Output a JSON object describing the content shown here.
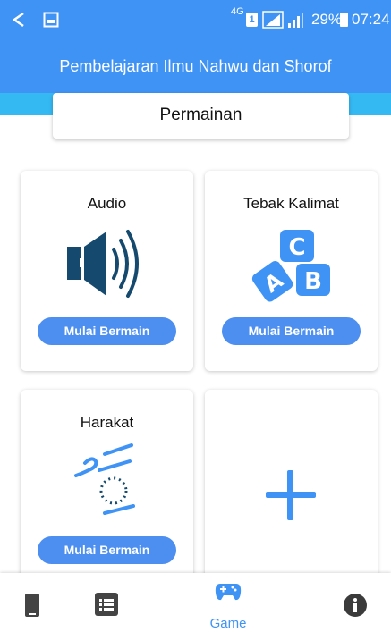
{
  "status_bar": {
    "network": "4G",
    "sim": "1",
    "battery": "29%",
    "time": "07:24"
  },
  "app_bar": {
    "title": "Pembelajaran Ilmu Nahwu dan Shorof"
  },
  "section": {
    "title": "Permainan"
  },
  "games": [
    {
      "title": "Audio",
      "icon": "speaker-icon",
      "button": "Mulai Bermain"
    },
    {
      "title": "Tebak Kalimat",
      "icon": "abc-blocks-icon",
      "button": "Mulai Bermain"
    },
    {
      "title": "Harakat",
      "icon": "harakat-icon",
      "button": "Mulai Bermain"
    },
    {
      "title": "",
      "icon": "plus-icon",
      "button": ""
    }
  ],
  "bottom_nav": {
    "items": [
      {
        "icon": "book-icon"
      },
      {
        "icon": "list-icon"
      },
      {
        "icon": "gamepad-icon",
        "label": "Game",
        "active": true
      },
      {
        "icon": "info-icon"
      }
    ]
  },
  "colors": {
    "primary": "#3f93f5",
    "accent_band": "#35b9f3",
    "button": "#4c8ff0",
    "icon_dark": "#154a6e"
  }
}
